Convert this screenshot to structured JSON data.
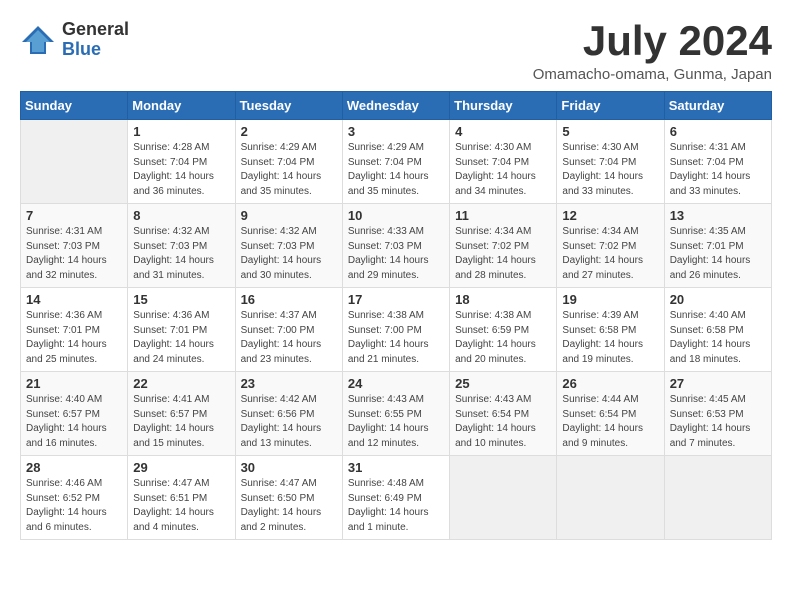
{
  "logo": {
    "general": "General",
    "blue": "Blue"
  },
  "title": "July 2024",
  "location": "Omamacho-omama, Gunma, Japan",
  "days_of_week": [
    "Sunday",
    "Monday",
    "Tuesday",
    "Wednesday",
    "Thursday",
    "Friday",
    "Saturday"
  ],
  "weeks": [
    [
      {
        "day": "",
        "sunrise": "",
        "sunset": "",
        "daylight": ""
      },
      {
        "day": "1",
        "sunrise": "Sunrise: 4:28 AM",
        "sunset": "Sunset: 7:04 PM",
        "daylight": "Daylight: 14 hours and 36 minutes."
      },
      {
        "day": "2",
        "sunrise": "Sunrise: 4:29 AM",
        "sunset": "Sunset: 7:04 PM",
        "daylight": "Daylight: 14 hours and 35 minutes."
      },
      {
        "day": "3",
        "sunrise": "Sunrise: 4:29 AM",
        "sunset": "Sunset: 7:04 PM",
        "daylight": "Daylight: 14 hours and 35 minutes."
      },
      {
        "day": "4",
        "sunrise": "Sunrise: 4:30 AM",
        "sunset": "Sunset: 7:04 PM",
        "daylight": "Daylight: 14 hours and 34 minutes."
      },
      {
        "day": "5",
        "sunrise": "Sunrise: 4:30 AM",
        "sunset": "Sunset: 7:04 PM",
        "daylight": "Daylight: 14 hours and 33 minutes."
      },
      {
        "day": "6",
        "sunrise": "Sunrise: 4:31 AM",
        "sunset": "Sunset: 7:04 PM",
        "daylight": "Daylight: 14 hours and 33 minutes."
      }
    ],
    [
      {
        "day": "7",
        "sunrise": "Sunrise: 4:31 AM",
        "sunset": "Sunset: 7:03 PM",
        "daylight": "Daylight: 14 hours and 32 minutes."
      },
      {
        "day": "8",
        "sunrise": "Sunrise: 4:32 AM",
        "sunset": "Sunset: 7:03 PM",
        "daylight": "Daylight: 14 hours and 31 minutes."
      },
      {
        "day": "9",
        "sunrise": "Sunrise: 4:32 AM",
        "sunset": "Sunset: 7:03 PM",
        "daylight": "Daylight: 14 hours and 30 minutes."
      },
      {
        "day": "10",
        "sunrise": "Sunrise: 4:33 AM",
        "sunset": "Sunset: 7:03 PM",
        "daylight": "Daylight: 14 hours and 29 minutes."
      },
      {
        "day": "11",
        "sunrise": "Sunrise: 4:34 AM",
        "sunset": "Sunset: 7:02 PM",
        "daylight": "Daylight: 14 hours and 28 minutes."
      },
      {
        "day": "12",
        "sunrise": "Sunrise: 4:34 AM",
        "sunset": "Sunset: 7:02 PM",
        "daylight": "Daylight: 14 hours and 27 minutes."
      },
      {
        "day": "13",
        "sunrise": "Sunrise: 4:35 AM",
        "sunset": "Sunset: 7:01 PM",
        "daylight": "Daylight: 14 hours and 26 minutes."
      }
    ],
    [
      {
        "day": "14",
        "sunrise": "Sunrise: 4:36 AM",
        "sunset": "Sunset: 7:01 PM",
        "daylight": "Daylight: 14 hours and 25 minutes."
      },
      {
        "day": "15",
        "sunrise": "Sunrise: 4:36 AM",
        "sunset": "Sunset: 7:01 PM",
        "daylight": "Daylight: 14 hours and 24 minutes."
      },
      {
        "day": "16",
        "sunrise": "Sunrise: 4:37 AM",
        "sunset": "Sunset: 7:00 PM",
        "daylight": "Daylight: 14 hours and 23 minutes."
      },
      {
        "day": "17",
        "sunrise": "Sunrise: 4:38 AM",
        "sunset": "Sunset: 7:00 PM",
        "daylight": "Daylight: 14 hours and 21 minutes."
      },
      {
        "day": "18",
        "sunrise": "Sunrise: 4:38 AM",
        "sunset": "Sunset: 6:59 PM",
        "daylight": "Daylight: 14 hours and 20 minutes."
      },
      {
        "day": "19",
        "sunrise": "Sunrise: 4:39 AM",
        "sunset": "Sunset: 6:58 PM",
        "daylight": "Daylight: 14 hours and 19 minutes."
      },
      {
        "day": "20",
        "sunrise": "Sunrise: 4:40 AM",
        "sunset": "Sunset: 6:58 PM",
        "daylight": "Daylight: 14 hours and 18 minutes."
      }
    ],
    [
      {
        "day": "21",
        "sunrise": "Sunrise: 4:40 AM",
        "sunset": "Sunset: 6:57 PM",
        "daylight": "Daylight: 14 hours and 16 minutes."
      },
      {
        "day": "22",
        "sunrise": "Sunrise: 4:41 AM",
        "sunset": "Sunset: 6:57 PM",
        "daylight": "Daylight: 14 hours and 15 minutes."
      },
      {
        "day": "23",
        "sunrise": "Sunrise: 4:42 AM",
        "sunset": "Sunset: 6:56 PM",
        "daylight": "Daylight: 14 hours and 13 minutes."
      },
      {
        "day": "24",
        "sunrise": "Sunrise: 4:43 AM",
        "sunset": "Sunset: 6:55 PM",
        "daylight": "Daylight: 14 hours and 12 minutes."
      },
      {
        "day": "25",
        "sunrise": "Sunrise: 4:43 AM",
        "sunset": "Sunset: 6:54 PM",
        "daylight": "Daylight: 14 hours and 10 minutes."
      },
      {
        "day": "26",
        "sunrise": "Sunrise: 4:44 AM",
        "sunset": "Sunset: 6:54 PM",
        "daylight": "Daylight: 14 hours and 9 minutes."
      },
      {
        "day": "27",
        "sunrise": "Sunrise: 4:45 AM",
        "sunset": "Sunset: 6:53 PM",
        "daylight": "Daylight: 14 hours and 7 minutes."
      }
    ],
    [
      {
        "day": "28",
        "sunrise": "Sunrise: 4:46 AM",
        "sunset": "Sunset: 6:52 PM",
        "daylight": "Daylight: 14 hours and 6 minutes."
      },
      {
        "day": "29",
        "sunrise": "Sunrise: 4:47 AM",
        "sunset": "Sunset: 6:51 PM",
        "daylight": "Daylight: 14 hours and 4 minutes."
      },
      {
        "day": "30",
        "sunrise": "Sunrise: 4:47 AM",
        "sunset": "Sunset: 6:50 PM",
        "daylight": "Daylight: 14 hours and 2 minutes."
      },
      {
        "day": "31",
        "sunrise": "Sunrise: 4:48 AM",
        "sunset": "Sunset: 6:49 PM",
        "daylight": "Daylight: 14 hours and 1 minute."
      },
      {
        "day": "",
        "sunrise": "",
        "sunset": "",
        "daylight": ""
      },
      {
        "day": "",
        "sunrise": "",
        "sunset": "",
        "daylight": ""
      },
      {
        "day": "",
        "sunrise": "",
        "sunset": "",
        "daylight": ""
      }
    ]
  ]
}
